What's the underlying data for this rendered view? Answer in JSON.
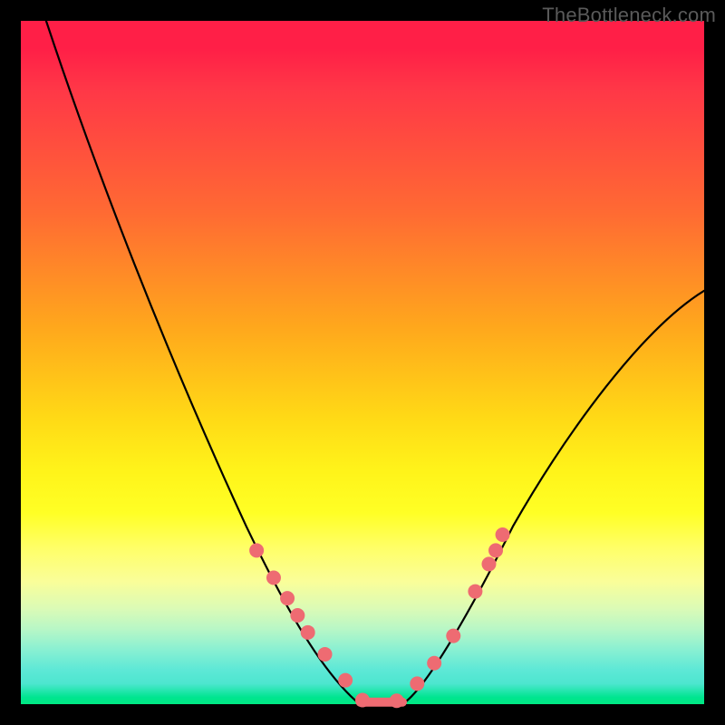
{
  "watermark": "TheBottleneck.com",
  "chart_data": {
    "type": "line",
    "title": "",
    "xlabel": "",
    "ylabel": "",
    "xlim": [
      0,
      1
    ],
    "ylim": [
      0,
      1
    ],
    "series": [
      {
        "name": "curve",
        "x": [
          0.0,
          0.05,
          0.1,
          0.15,
          0.2,
          0.25,
          0.3,
          0.35,
          0.4,
          0.45,
          0.475,
          0.49,
          0.5,
          0.55,
          0.6,
          0.65,
          0.7,
          0.75,
          0.8,
          0.85,
          0.9,
          0.95,
          1.0
        ],
        "y": [
          1.0,
          0.87,
          0.75,
          0.63,
          0.52,
          0.41,
          0.31,
          0.22,
          0.14,
          0.07,
          0.03,
          0.01,
          0.0,
          0.0,
          0.04,
          0.1,
          0.18,
          0.27,
          0.36,
          0.44,
          0.51,
          0.57,
          0.61
        ]
      }
    ],
    "markers": {
      "visible_points": [
        {
          "x": 0.345,
          "y": 0.225
        },
        {
          "x": 0.37,
          "y": 0.185
        },
        {
          "x": 0.39,
          "y": 0.155
        },
        {
          "x": 0.405,
          "y": 0.13
        },
        {
          "x": 0.42,
          "y": 0.105
        },
        {
          "x": 0.445,
          "y": 0.073
        },
        {
          "x": 0.475,
          "y": 0.035
        },
        {
          "x": 0.5,
          "y": 0.006
        },
        {
          "x": 0.55,
          "y": 0.005
        },
        {
          "x": 0.58,
          "y": 0.03
        },
        {
          "x": 0.605,
          "y": 0.06
        },
        {
          "x": 0.633,
          "y": 0.1
        },
        {
          "x": 0.665,
          "y": 0.165
        },
        {
          "x": 0.685,
          "y": 0.205
        },
        {
          "x": 0.695,
          "y": 0.225
        },
        {
          "x": 0.705,
          "y": 0.248
        }
      ],
      "color": "#ee6b72",
      "radius": 8
    },
    "flat_bottom": {
      "x_start": 0.49,
      "x_end": 0.565,
      "y": 0.003
    },
    "gradient_stops": [
      {
        "pos": 0.0,
        "color": "#ff1f47"
      },
      {
        "pos": 0.3,
        "color": "#ff7a28"
      },
      {
        "pos": 0.55,
        "color": "#ffd916"
      },
      {
        "pos": 0.72,
        "color": "#ffff25"
      },
      {
        "pos": 0.9,
        "color": "#8af0d2"
      },
      {
        "pos": 1.0,
        "color": "#00e882"
      }
    ]
  }
}
